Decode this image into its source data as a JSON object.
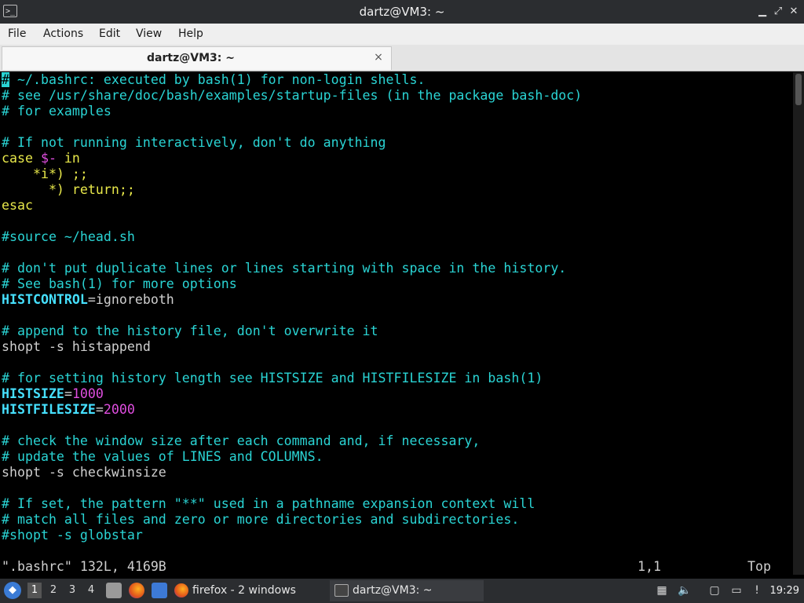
{
  "window": {
    "title": "dartz@VM3: ~",
    "controls": [
      "minimize-icon",
      "restore-icon",
      "close-icon"
    ]
  },
  "menu": {
    "items": [
      "File",
      "Actions",
      "Edit",
      "View",
      "Help"
    ]
  },
  "tab": {
    "label": "dartz@VM3: ~",
    "close": "×"
  },
  "terminal": {
    "lines": [
      [
        {
          "t": "#",
          "s": "cursor"
        },
        {
          "t": " ~/.bashrc: executed by bash(1) for non-login shells.",
          "s": "c"
        }
      ],
      [
        {
          "t": "# see /usr/share/doc/bash/examples/startup-files (in the package bash-doc)",
          "s": "c"
        }
      ],
      [
        {
          "t": "# for examples",
          "s": "c"
        }
      ],
      [],
      [
        {
          "t": "# If not running interactively, don't do anything",
          "s": "c"
        }
      ],
      [
        {
          "t": "case ",
          "s": "y"
        },
        {
          "t": "$-",
          "s": "m"
        },
        {
          "t": " in",
          "s": "y"
        }
      ],
      [
        {
          "t": "    *i*) ;;",
          "s": "y"
        }
      ],
      [
        {
          "t": "      *) return;;",
          "s": "y"
        }
      ],
      [
        {
          "t": "esac",
          "s": "y"
        }
      ],
      [],
      [
        {
          "t": "#source ~/head.sh",
          "s": "c"
        }
      ],
      [],
      [
        {
          "t": "# don't put duplicate lines or lines starting with space in the history.",
          "s": "c"
        }
      ],
      [
        {
          "t": "# See bash(1) for more options",
          "s": "c"
        }
      ],
      [
        {
          "t": "HISTCONTROL",
          "s": "b"
        },
        {
          "t": "=ignoreboth",
          "s": "w"
        }
      ],
      [],
      [
        {
          "t": "# append to the history file, don't overwrite it",
          "s": "c"
        }
      ],
      [
        {
          "t": "shopt -s histappend",
          "s": "w"
        }
      ],
      [],
      [
        {
          "t": "# for setting history length see HISTSIZE and HISTFILESIZE in bash(1)",
          "s": "c"
        }
      ],
      [
        {
          "t": "HISTSIZE",
          "s": "b"
        },
        {
          "t": "=",
          "s": "w"
        },
        {
          "t": "1000",
          "s": "m"
        }
      ],
      [
        {
          "t": "HISTFILESIZE",
          "s": "b"
        },
        {
          "t": "=",
          "s": "w"
        },
        {
          "t": "2000",
          "s": "m"
        }
      ],
      [],
      [
        {
          "t": "# check the window size after each command and, if necessary,",
          "s": "c"
        }
      ],
      [
        {
          "t": "# update the values of LINES and COLUMNS.",
          "s": "c"
        }
      ],
      [
        {
          "t": "shopt -s checkwinsize",
          "s": "w"
        }
      ],
      [],
      [
        {
          "t": "# If set, the pattern \"**\" used in a pathname expansion context will",
          "s": "c"
        }
      ],
      [
        {
          "t": "# match all files and zero or more directories and subdirectories.",
          "s": "c"
        }
      ],
      [
        {
          "t": "#shopt -s globstar",
          "s": "c"
        }
      ],
      [],
      [
        {
          "t": "\".bashrc\" 132L, 4169B",
          "s": "w"
        }
      ]
    ],
    "ruler_position": "1,1",
    "ruler_scroll": "Top"
  },
  "taskbar": {
    "workspaces": [
      "1",
      "2",
      "3",
      "4"
    ],
    "active_workspace": "1",
    "tasks": [
      {
        "label": "firefox - 2 windows",
        "icon": "firefox-icon"
      },
      {
        "label": "dartz@VM3: ~",
        "icon": "terminal-icon"
      }
    ],
    "clock": "19:29"
  },
  "colors": {
    "comment": "#2ad4d4",
    "keyword": "#e8e84a",
    "variable": "#46e0ff",
    "number": "#e04ee0",
    "titlebar": "#2b2d30"
  }
}
